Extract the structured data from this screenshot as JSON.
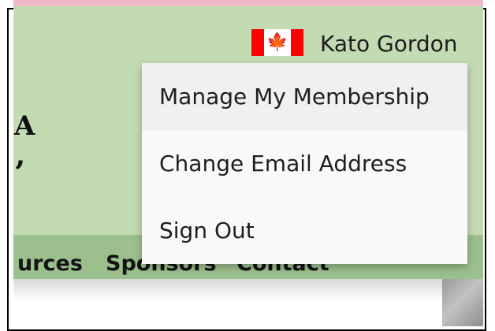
{
  "header": {
    "user_name": "Kato Gordon",
    "logo_fragments": [
      "A",
      "’"
    ]
  },
  "nav": {
    "items": [
      "urces",
      "Sponsors",
      "Contact"
    ]
  },
  "account_menu": {
    "items": [
      {
        "label": "Manage My Membership",
        "hovered": true
      },
      {
        "label": "Change Email Address",
        "hovered": false
      },
      {
        "label": "Sign Out",
        "hovered": false
      }
    ]
  },
  "colors": {
    "header_bg": "#c3dbb3",
    "nav_bg": "#9cc08d",
    "menu_bg": "#f9f9f9",
    "menu_hover_bg": "#f0f0f0",
    "top_strip": "#f0b9c9",
    "flag_red": "#ff0000"
  },
  "icons": {
    "flag": "canada-flag-icon",
    "leaf": "maple-leaf-icon"
  }
}
